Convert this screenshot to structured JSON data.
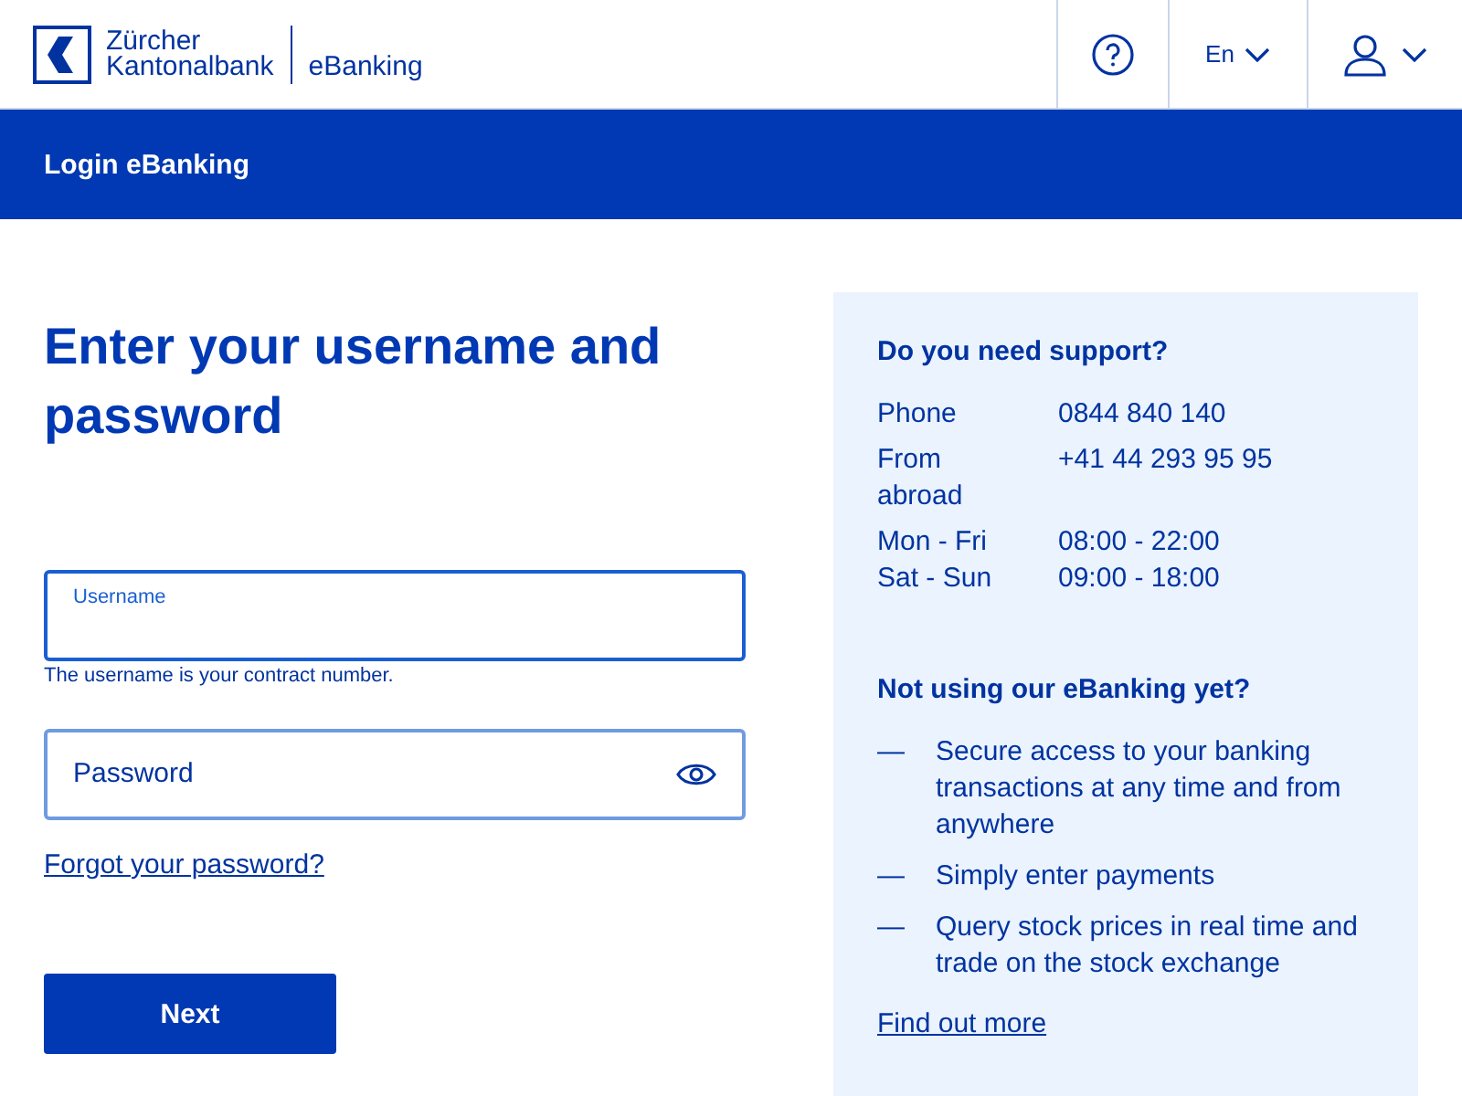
{
  "header": {
    "logo_lines": [
      "Zürcher",
      "Kantonalbank"
    ],
    "product": "eBanking",
    "language": "En"
  },
  "nav_bar": {
    "title": "Login eBanking"
  },
  "form": {
    "heading": "Enter your username and password",
    "fields": [
      {
        "kind": "text",
        "label": "Username",
        "focused": true,
        "hint": "The username is your contract number."
      },
      {
        "kind": "password",
        "placeholder": "Password",
        "focused": false
      }
    ],
    "forgot_link": "Forgot your password?",
    "submit": "Next"
  },
  "support": {
    "heading": "Do you need support?",
    "contacts": [
      {
        "label": "Phone",
        "value": "0844 840 140"
      },
      {
        "label": "From abroad",
        "value": "+41 44 293 95 95"
      }
    ],
    "hours": [
      {
        "label": "Mon - Fri",
        "value": "08:00 - 22:00"
      },
      {
        "label": "Sat - Sun",
        "value": "09:00 - 18:00"
      }
    ],
    "promo_heading": "Not using our eBanking yet?",
    "benefits": [
      {
        "bullet": "—",
        "text": "Secure access to your banking transactions at any time and from anywhere"
      },
      {
        "bullet": "—",
        "text": "Simply enter payments"
      },
      {
        "bullet": "—",
        "text": "Query stock prices in real time and trade on the stock exchange"
      }
    ],
    "more_link": "Find out more"
  }
}
